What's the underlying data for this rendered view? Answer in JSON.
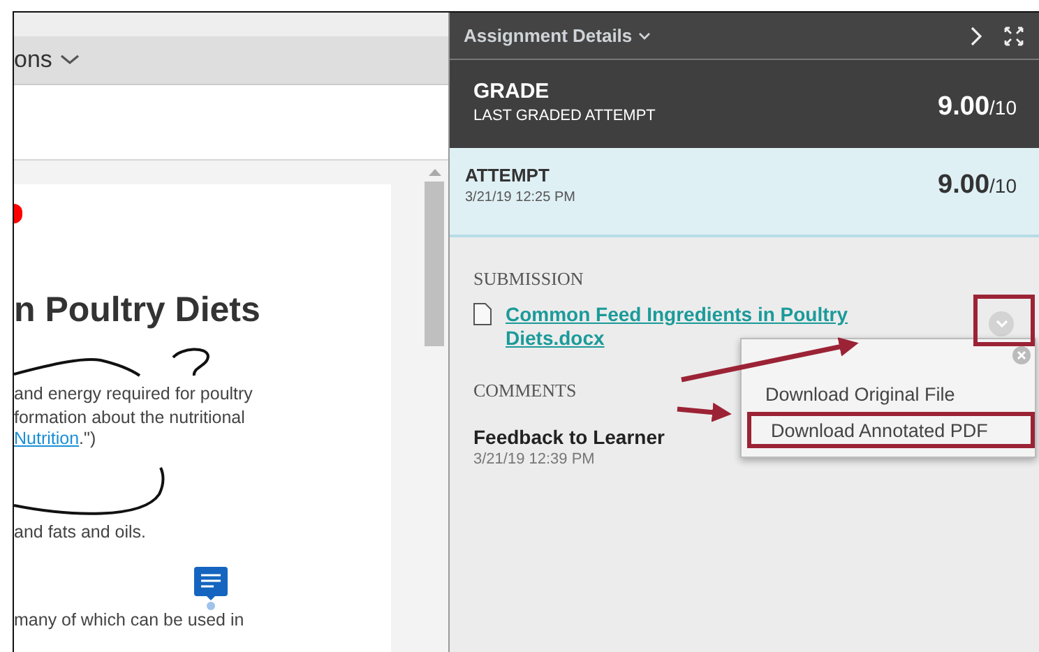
{
  "toolbar": {
    "menu_label": "ons"
  },
  "document": {
    "heading": "n Poultry Diets",
    "lines": [
      {
        "kind": "text",
        "text": "and energy required for poultry"
      },
      {
        "kind": "text",
        "text": "formation about the nutritional"
      },
      {
        "kind": "link",
        "link": "Nutrition",
        "after": ".\")"
      },
      {
        "kind": "text",
        "text": "and fats and oils."
      },
      {
        "kind": "comment"
      },
      {
        "kind": "text",
        "text": "many of which can be used in"
      }
    ]
  },
  "panel": {
    "title": "Assignment Details",
    "grade": {
      "label": "GRADE",
      "sublabel": "LAST GRADED ATTEMPT",
      "score": "9.00",
      "total": "/10"
    },
    "attempt": {
      "label": "ATTEMPT",
      "date": "3/21/19 12:25 PM",
      "score": "9.00",
      "total": "/10"
    },
    "submission": {
      "heading": "SUBMISSION",
      "file": "Common Feed Ingredients in Poultry Diets.docx"
    },
    "comments": {
      "heading": "COMMENTS",
      "title": "Feedback to Learner",
      "date": "3/21/19 12:39 PM"
    },
    "menu": {
      "items": [
        {
          "label": "Download Original File",
          "highlighted": false
        },
        {
          "label": "Download Annotated PDF",
          "highlighted": true
        }
      ]
    }
  }
}
